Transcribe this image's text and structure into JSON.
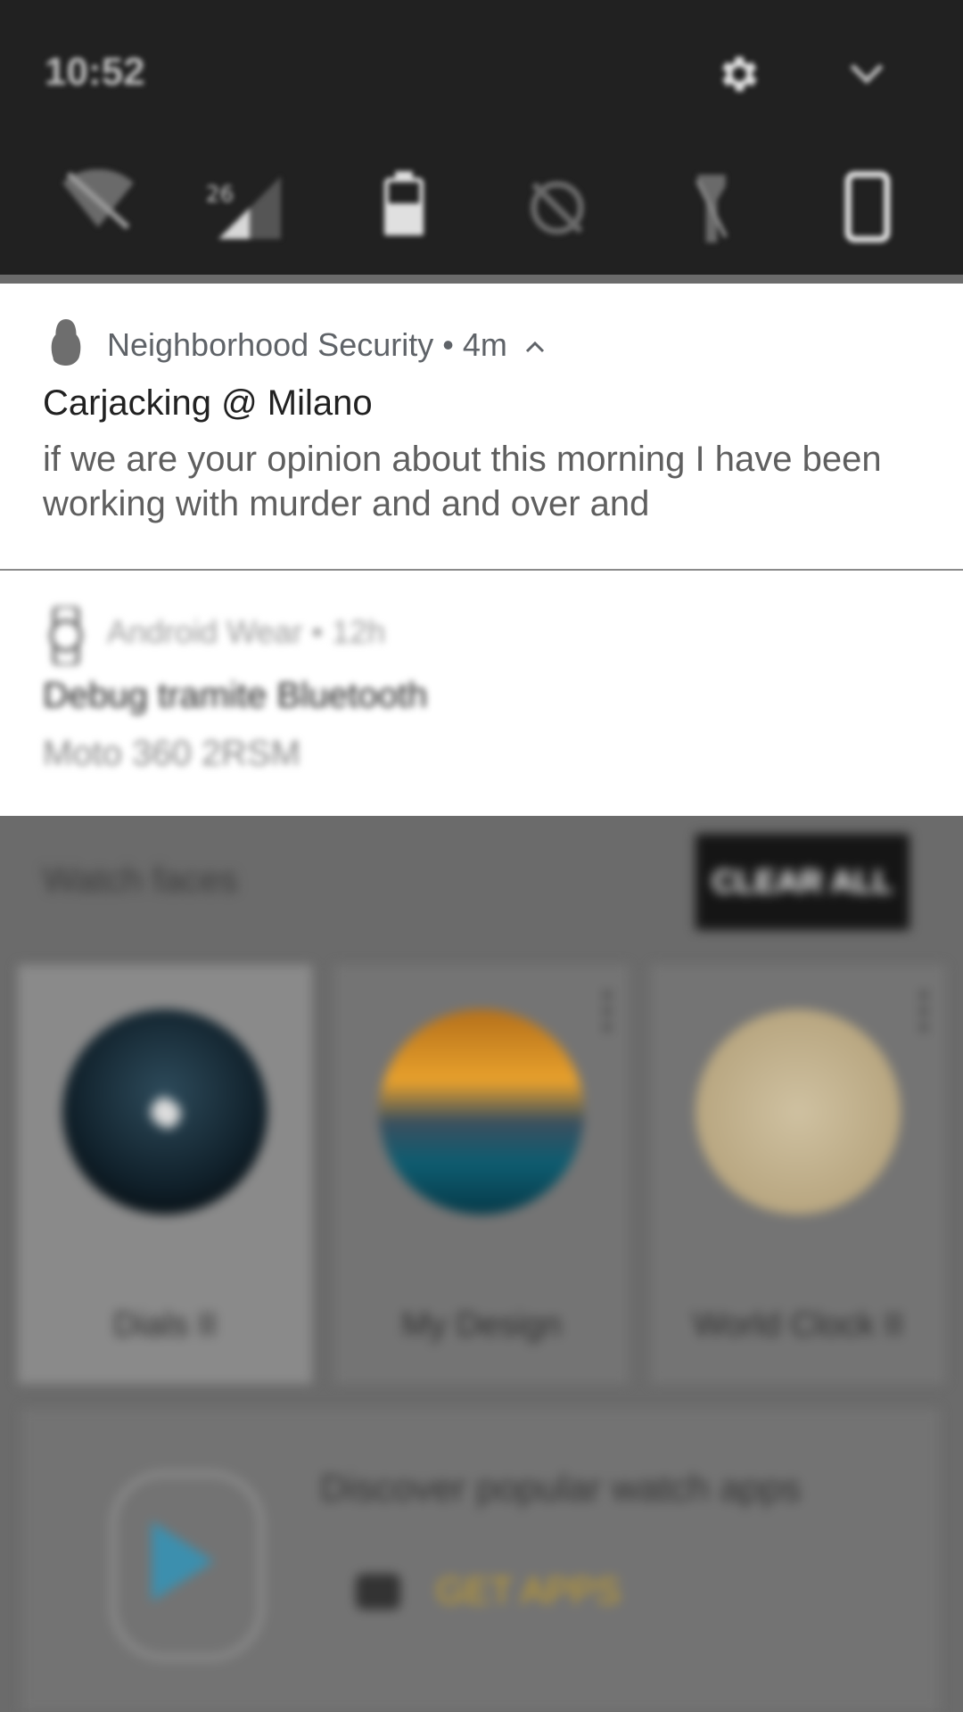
{
  "status_bar": {
    "time": "10:52"
  },
  "quick_settings": {
    "icons": [
      "wifi-icon",
      "cellular-signal-icon",
      "battery-icon",
      "rotation-icon",
      "flashlight-icon",
      "phone-icon"
    ]
  },
  "notifications": [
    {
      "app_name": "Neighborhood Security",
      "separator": "•",
      "time": "4m",
      "title": "Carjacking @ Milano",
      "body": "if we are your opinion about this morning I have been working with murder and and over and"
    },
    {
      "app_name": "Android Wear",
      "separator": "•",
      "time": "12h",
      "title": "Debug tramite Bluetooth",
      "body": "Moto 360 2RSM"
    }
  ],
  "background_app": {
    "section_title": "Watch faces",
    "clear_all_label": "CLEAR ALL",
    "watch_faces": [
      {
        "label": "Dials II"
      },
      {
        "label": "My Design"
      },
      {
        "label": "World Clock II"
      }
    ],
    "promo": {
      "text": "Discover popular watch apps",
      "button_label": "GET APPS"
    }
  },
  "colors": {
    "shade_bg": "#212121",
    "notification_bg": "#ffffff",
    "scrim": "#6b6b6b",
    "accent_get_apps": "#c8a02a"
  }
}
